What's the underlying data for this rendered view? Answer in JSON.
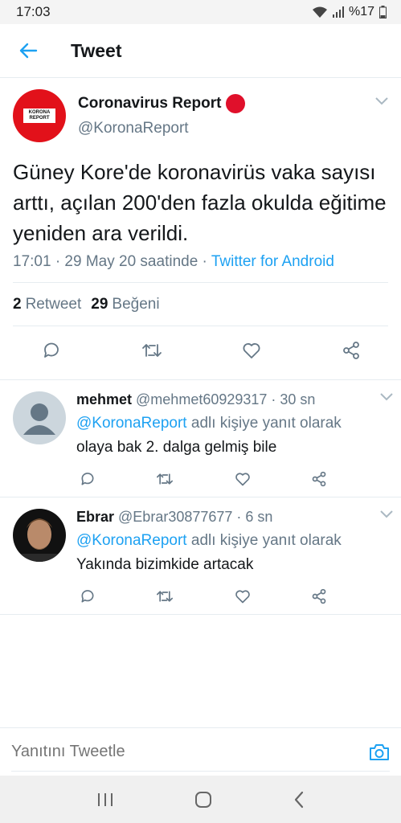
{
  "status_bar": {
    "time": "17:03",
    "battery": "%17"
  },
  "app_bar": {
    "title": "Tweet"
  },
  "tweet": {
    "author_name": "Coronavirus Report",
    "author_handle": "@KoronaReport",
    "logo_line1": "KORONA",
    "logo_line2": "REPORT",
    "text": "Güney Kore'de koronavirüs vaka sayısı arttı, açılan 200'den fazla okulda eğitime yeniden ara verildi.",
    "timestamp": "17:01 · 29 May 20 saatinde · ",
    "source": "Twitter for Android",
    "retweet_count": "2",
    "retweet_label": "Retweet",
    "like_count": "29",
    "like_label": "Beğeni"
  },
  "replies": [
    {
      "name": "mehmet",
      "meta": "@mehmet60929317 · 30 sn",
      "reply_mention": "@KoronaReport",
      "reply_suffix": " adlı kişiye yanıt olarak",
      "text": "olaya bak 2. dalga gelmiş bile"
    },
    {
      "name": "Ebrar",
      "meta": "@Ebrar30877677 · 6 sn",
      "reply_mention": "@KoronaReport",
      "reply_suffix": " adlı kişiye yanıt olarak",
      "text": "Yakında bizimkide artacak"
    }
  ],
  "compose": {
    "placeholder": "Yanıtını Tweetle"
  },
  "colors": {
    "accent": "#1da1f2",
    "muted": "#657786",
    "text": "#14171a",
    "brand_red": "#e2111a"
  }
}
